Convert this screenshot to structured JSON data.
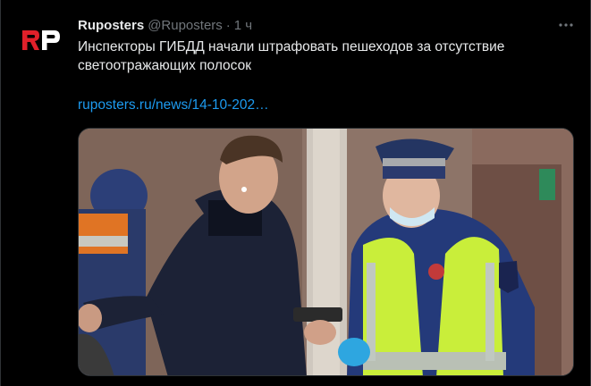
{
  "author": {
    "avatar_text": "RP",
    "name": "Ruposters",
    "handle": "@Ruposters",
    "separator": "·",
    "time": "1 ч"
  },
  "tweet": {
    "text": "Инспекторы ГИБДД начали штрафовать пешеходов за отсутствие светоотражающих полосок",
    "link": "ruposters.ru/news/14-10-202…"
  },
  "icons": {
    "more": "more-horizontal-icon"
  },
  "colors": {
    "background": "#000000",
    "text": "#e7e9ea",
    "secondary": "#71767b",
    "link": "#1d9bf0",
    "brand_red": "#e0202a"
  }
}
